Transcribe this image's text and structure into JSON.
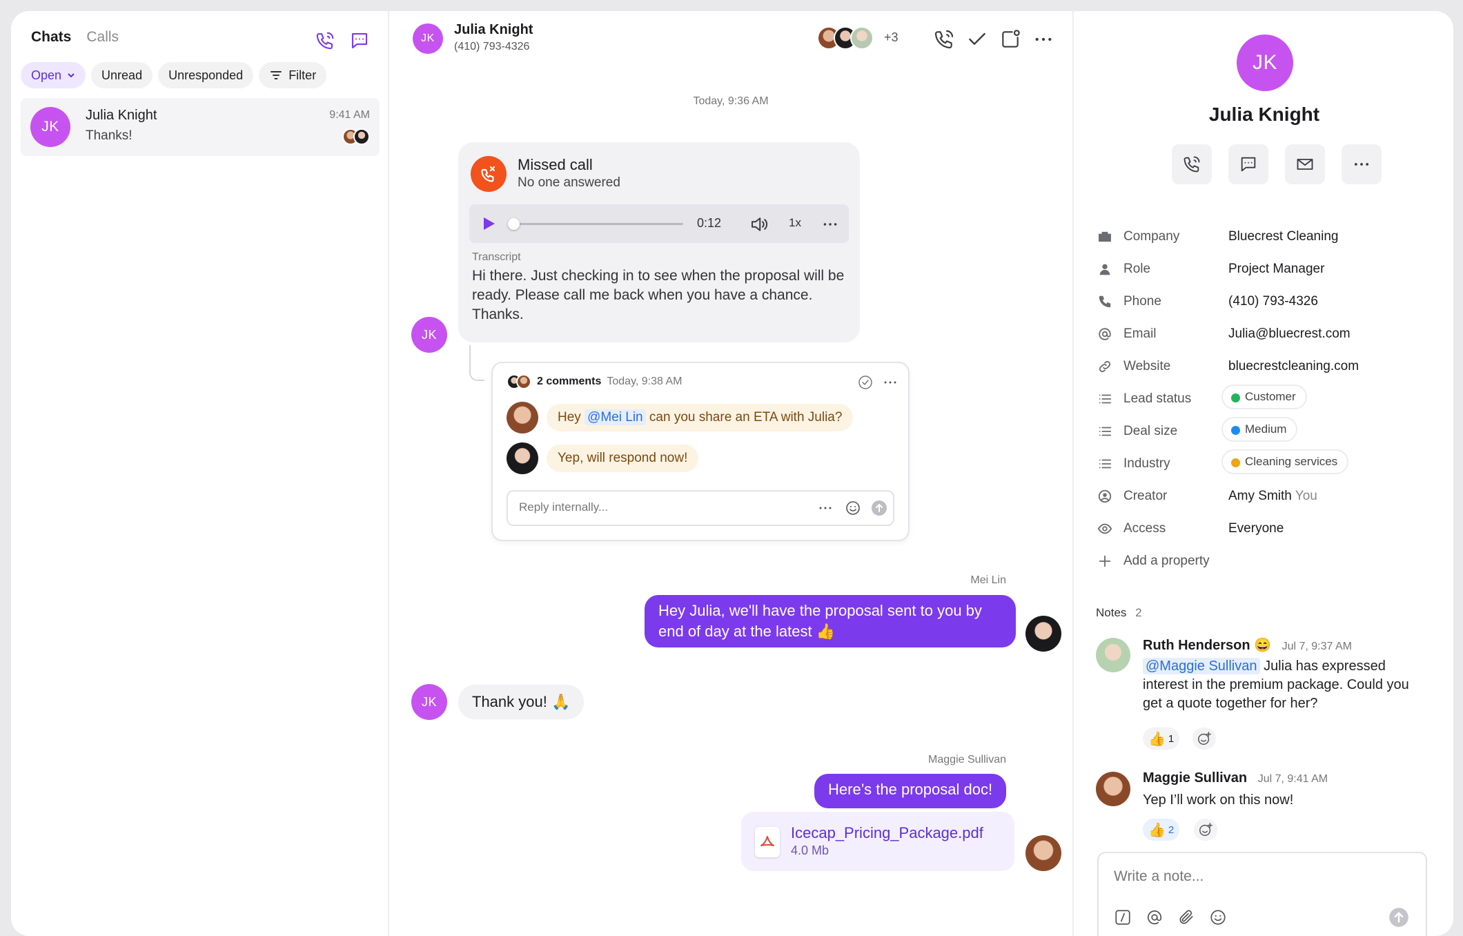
{
  "left": {
    "tabs": [
      "Chats",
      "Calls"
    ],
    "chips": {
      "open": "Open",
      "unread": "Unread",
      "unresponded": "Unresponded",
      "filter": "Filter"
    },
    "conversation": {
      "initials": "JK",
      "name": "Julia Knight",
      "preview": "Thanks!",
      "time": "9:41 AM"
    }
  },
  "header": {
    "initials": "JK",
    "name": "Julia Knight",
    "phone": "(410) 793-4326",
    "extra_count": "+3"
  },
  "chat": {
    "day_stamp": "Today, 9:36 AM",
    "call": {
      "title": "Missed call",
      "subtitle": "No one answered",
      "duration": "0:12",
      "speed": "1x",
      "transcript_label": "Transcript",
      "transcript": "Hi there. Just checking in to see when the proposal will be ready. Please call me back when you have a chance. Thanks.",
      "avatar": "JK"
    },
    "thread": {
      "count": "2 comments",
      "time": "Today, 9:38 AM",
      "c1_pre": "Hey",
      "c1_mention": "@Mei Lin",
      "c1_post": "can you share an ETA with Julia?",
      "c2": "Yep, will respond now!",
      "reply_placeholder": "Reply internally..."
    },
    "msg1": {
      "author": "Mei Lin",
      "text": "Hey Julia, we'll have the proposal sent to you by end of day at the latest 👍"
    },
    "msg2": {
      "avatar": "JK",
      "text": "Thank you! 🙏"
    },
    "msg3": {
      "author": "Maggie Sullivan",
      "text": "Here’s the proposal doc!"
    },
    "file": {
      "name": "Icecap_Pricing_Package.pdf",
      "size": "4.0 Mb"
    }
  },
  "contact": {
    "initials": "JK",
    "name": "Julia Knight",
    "props": {
      "company": {
        "k": "Company",
        "v": "Bluecrest Cleaning"
      },
      "role": {
        "k": "Role",
        "v": "Project Manager"
      },
      "phone": {
        "k": "Phone",
        "v": "(410) 793-4326"
      },
      "email": {
        "k": "Email",
        "v": "Julia@bluecrest.com"
      },
      "website": {
        "k": "Website",
        "v": "bluecrestcleaning.com"
      },
      "lead": {
        "k": "Lead status",
        "v": "Customer",
        "color": "#22b45a"
      },
      "deal": {
        "k": "Deal size",
        "v": "Medium",
        "color": "#1a8cf0"
      },
      "industry": {
        "k": "Industry",
        "v": "Cleaning services",
        "color": "#f0a415"
      },
      "creator": {
        "k": "Creator",
        "v": "Amy Smith",
        "you": "You"
      },
      "access": {
        "k": "Access",
        "v": "Everyone"
      },
      "add": "Add a property"
    },
    "notes": {
      "label": "Notes",
      "count": "2",
      "n1": {
        "author": "Ruth Henderson",
        "emoji": "😄",
        "date": "Jul 7, 9:37 AM",
        "mention": "@Maggie Sullivan",
        "text": "Julia has expressed interest in the premium package. Could you get a quote together for her?",
        "react": "👍",
        "react_count": "1"
      },
      "n2": {
        "author": "Maggie Sullivan",
        "date": "Jul 7, 9:41 AM",
        "text": "Yep I’ll work on this now!",
        "react": "👍",
        "react_count": "2"
      },
      "placeholder": "Write a note..."
    }
  }
}
